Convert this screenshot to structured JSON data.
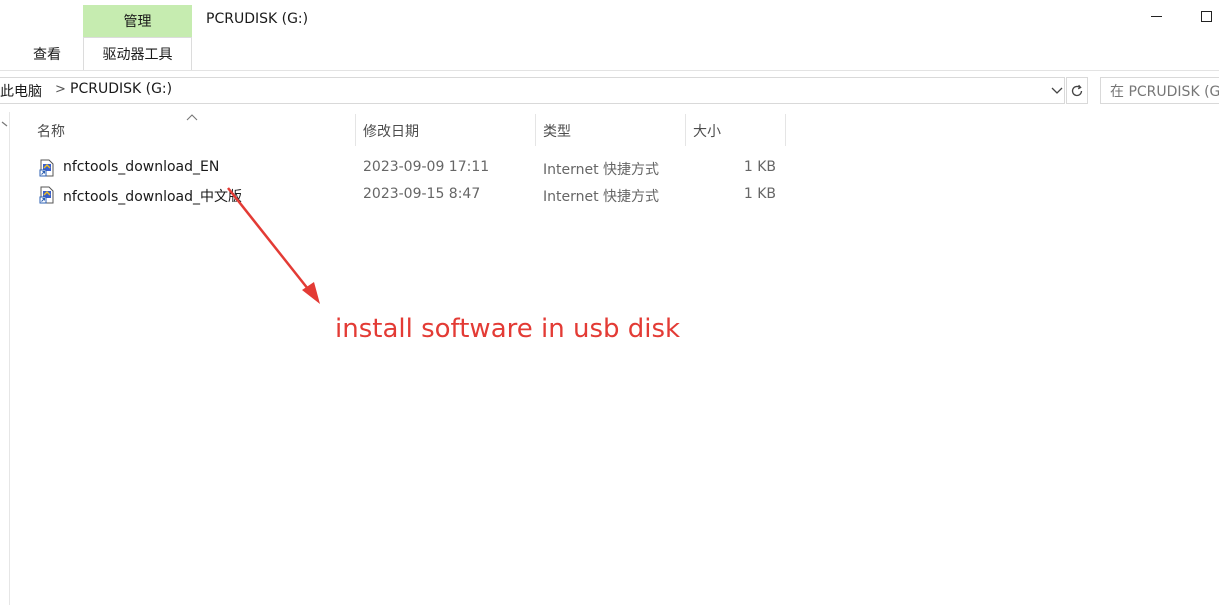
{
  "ribbon": {
    "view_tab": "查看",
    "manage_tab": "管理",
    "drive_tools_tab": "驱动器工具"
  },
  "window": {
    "title": "PCRUDISK (G:)"
  },
  "address": {
    "crumb_pc": "此电脑",
    "separator": ">",
    "crumb_drive": "PCRUDISK (G:)"
  },
  "search": {
    "placeholder": "在 PCRUDISK (G:)"
  },
  "columns": {
    "name": "名称",
    "date": "修改日期",
    "type": "类型",
    "size": "大小"
  },
  "files": [
    {
      "name": "nfctools_download_EN",
      "date": "2023-09-09 17:11",
      "type": "Internet 快捷方式",
      "size": "1 KB"
    },
    {
      "name": "nfctools_download_中文版",
      "date": "2023-09-15 8:47",
      "type": "Internet 快捷方式",
      "size": "1 KB"
    }
  ],
  "annotation": {
    "text": "install software in usb disk",
    "color": "#e33b35"
  },
  "colors": {
    "manage_tab_bg": "#c6ecb0"
  },
  "icons": {
    "file": "internet-shortcut-icon",
    "refresh": "refresh-icon",
    "dropdown": "chevron-down-icon",
    "minimize": "minimize-icon",
    "maximize": "maximize-icon"
  }
}
